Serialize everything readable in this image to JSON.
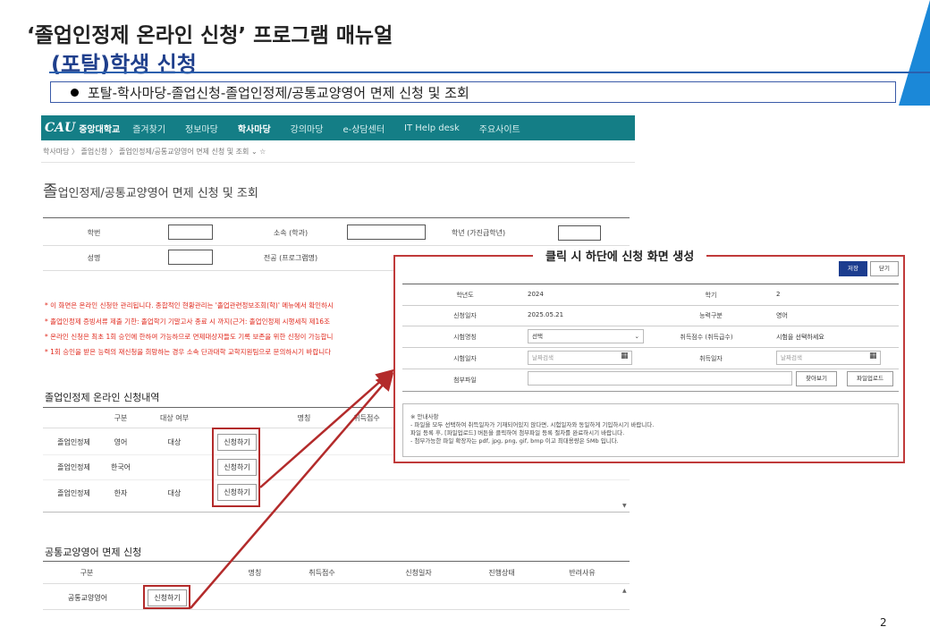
{
  "slide": {
    "title": "‘졸업인정제 온라인 신청’ 프로그램 매뉴얼",
    "subtitle": "(포탈)학생 신청",
    "bullet": "포탈-학사마당-졸업신청-졸업인정제/공통교양영어 면제 신청 및 조회",
    "callout": "클릭 시 하단에 신청 화면 생성",
    "page_number": "2",
    "accent_color": "#1b88d8"
  },
  "portal": {
    "logo": "CAU",
    "university": "중앙대학교",
    "nav": [
      "즐겨찾기",
      "정보마당",
      "학사마당",
      "강의마당",
      "e-상담센터",
      "IT Help desk",
      "주요사이트"
    ],
    "active_nav": "학사마당",
    "breadcrumb": "학사마당  〉 졸업신청  〉 졸업인정제/공통교양영어 면제 신청 및 조회 ⌄ ☆",
    "page_title_first": "졸",
    "page_title_rest": "업인정제/공통교양영어 면제 신청 및 조회",
    "form": {
      "student_id_label": "학번",
      "dept_label": "소속 (학과)",
      "grade_label": "학년 (가진급학년)",
      "name_label": "성명",
      "major_label": "전공 (프로그램명)"
    },
    "notices": [
      "* 이 화면은 온라인 신청만 관리됩니다. 종합적인 현황관리는 '졸업관련정보조회(학)' 메뉴에서 확인하시",
      "* 졸업인정제 증빙서류 제출 기한: 졸업학기 기말고사 종료 시 까지(근거: 졸업인정제 시행세칙 제16조 ",
      "* 온라인 신청은 최초 1회 승인에 한하여 가능하므로 면제대상자들도 기록 보존을 위한 신청이 가능합니",
      "* 1회 승인을 받은 능력의 재신청을 희망하는 경우 소속 단과대학 교학지원팀으로 문의하시기 바랍니다"
    ],
    "grad_section": {
      "title": "졸업인정제 온라인 신청내역",
      "headers": [
        "구분",
        "대상 여부",
        "명칭",
        "취득점수"
      ],
      "rows": [
        {
          "type": "졸업인정제",
          "name": "영어",
          "target": "대상",
          "button": "신청하기"
        },
        {
          "type": "졸업인정제",
          "name": "한국어",
          "target": "",
          "button": "신청하기"
        },
        {
          "type": "졸업인정제",
          "name": "한자",
          "target": "대상",
          "button": "신청하기"
        }
      ]
    },
    "english_section": {
      "title": "공통교양영어 면제 신청",
      "headers": [
        "구분",
        "명칭",
        "취득점수",
        "신청일자",
        "진행상태",
        "반려사유"
      ],
      "row": {
        "type": "공통교양영어",
        "button": "신청하기"
      }
    }
  },
  "popup": {
    "save": "저장",
    "close": "닫기",
    "year_label": "학년도",
    "year": "2024",
    "semester_label": "학기",
    "semester": "2",
    "date_label": "신청일자",
    "date": "2025.05.21",
    "category_label": "능력구분",
    "category": "영어",
    "exam_label": "시험명칭",
    "exam_value": "선택",
    "score_label": "취득점수 (취득급수)",
    "score_placeholder": "시험을 선택하세요",
    "test_date_label": "시험일자",
    "acq_date_label": "취득일자",
    "date_placeholder": "날짜검색",
    "attach_label": "첨부파일",
    "find_button": "찾아보기",
    "upload_button": "파일업로드",
    "guide": [
      "※ 안내사항",
      "- 파일을 모두 선택하여 취득일자가 기재되어있지 않다면, 시험일자와 동일하게 기입하시기 바랍니다.",
      "   파일 등록 후, [파일업로드] 버튼을 클릭하여 첨부파일 등록 절차를 완료하시기 바랍니다.",
      "- 첨부가능한 파일 확장자는 pdf, jpg, png, gif, bmp 이고 최대용량은 5Mb 입니다."
    ]
  }
}
